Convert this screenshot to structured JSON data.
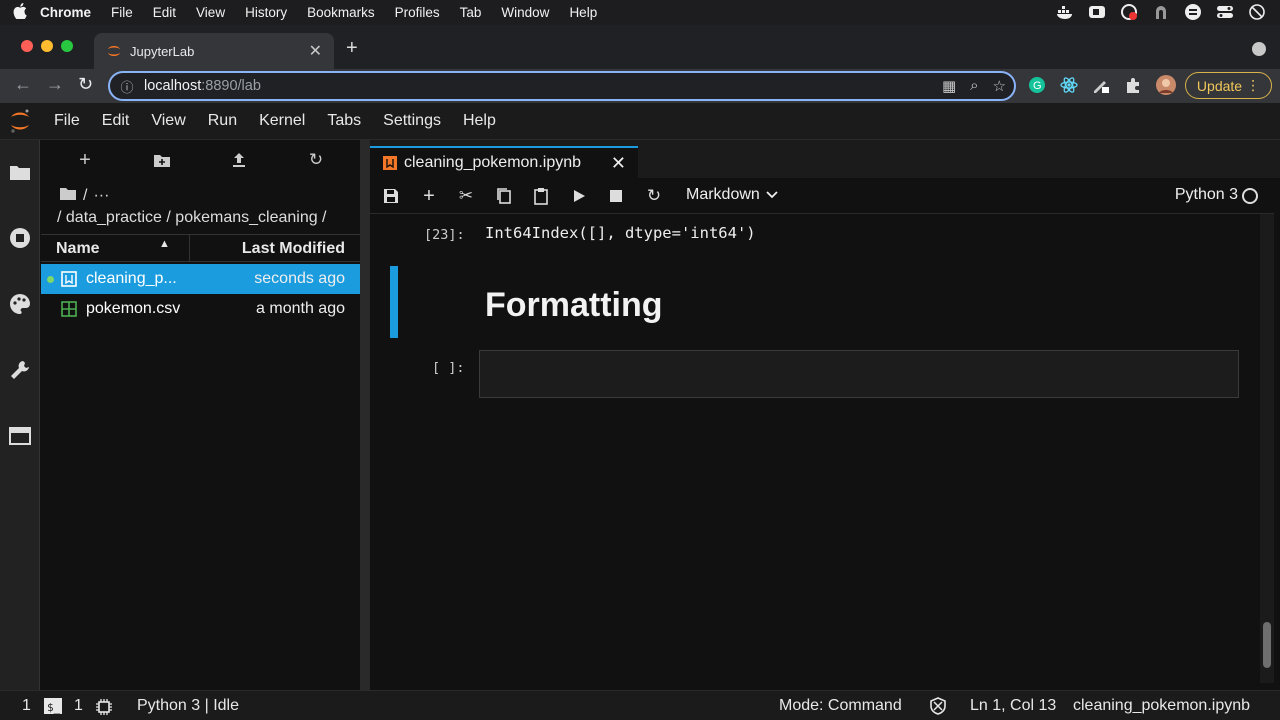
{
  "mac_menubar": {
    "items": [
      "Chrome",
      "File",
      "Edit",
      "View",
      "History",
      "Bookmarks",
      "Profiles",
      "Tab",
      "Window",
      "Help"
    ]
  },
  "chrome": {
    "tab_title": "JupyterLab",
    "url_host": "localhost",
    "url_rest": ":8890/lab",
    "update_label": "Update"
  },
  "jupyter": {
    "menu": [
      "File",
      "Edit",
      "View",
      "Run",
      "Kernel",
      "Tabs",
      "Settings",
      "Help"
    ]
  },
  "filebrowser": {
    "crumb_root": "/",
    "crumb_more": "···",
    "path": "/ data_practice / pokemans_cleaning /",
    "col_name": "Name",
    "col_modified": "Last Modified",
    "files": [
      {
        "name": "cleaning_p...",
        "modified": "seconds ago",
        "type": "notebook",
        "selected": true,
        "running": true
      },
      {
        "name": "pokemon.csv",
        "modified": "a month ago",
        "type": "csv",
        "selected": false,
        "running": false
      }
    ]
  },
  "notebook": {
    "tab_title": "cleaning_pokemon.ipynb",
    "cell_type": "Markdown",
    "kernel": "Python 3",
    "output_prompt": "[23]:",
    "output_text": "Int64Index([], dtype='int64')",
    "heading": "Formatting",
    "input_prompt": "[ ]:"
  },
  "statusbar": {
    "terminals": "1",
    "kernels": "1",
    "kernel_status": "Python 3 | Idle",
    "mode": "Mode: Command",
    "position": "Ln 1, Col 13",
    "filename": "cleaning_pokemon.ipynb"
  },
  "colors": {
    "accent": "#1a9cde",
    "jupyter_orange": "#f37726",
    "update_gold": "#f0c75a"
  }
}
